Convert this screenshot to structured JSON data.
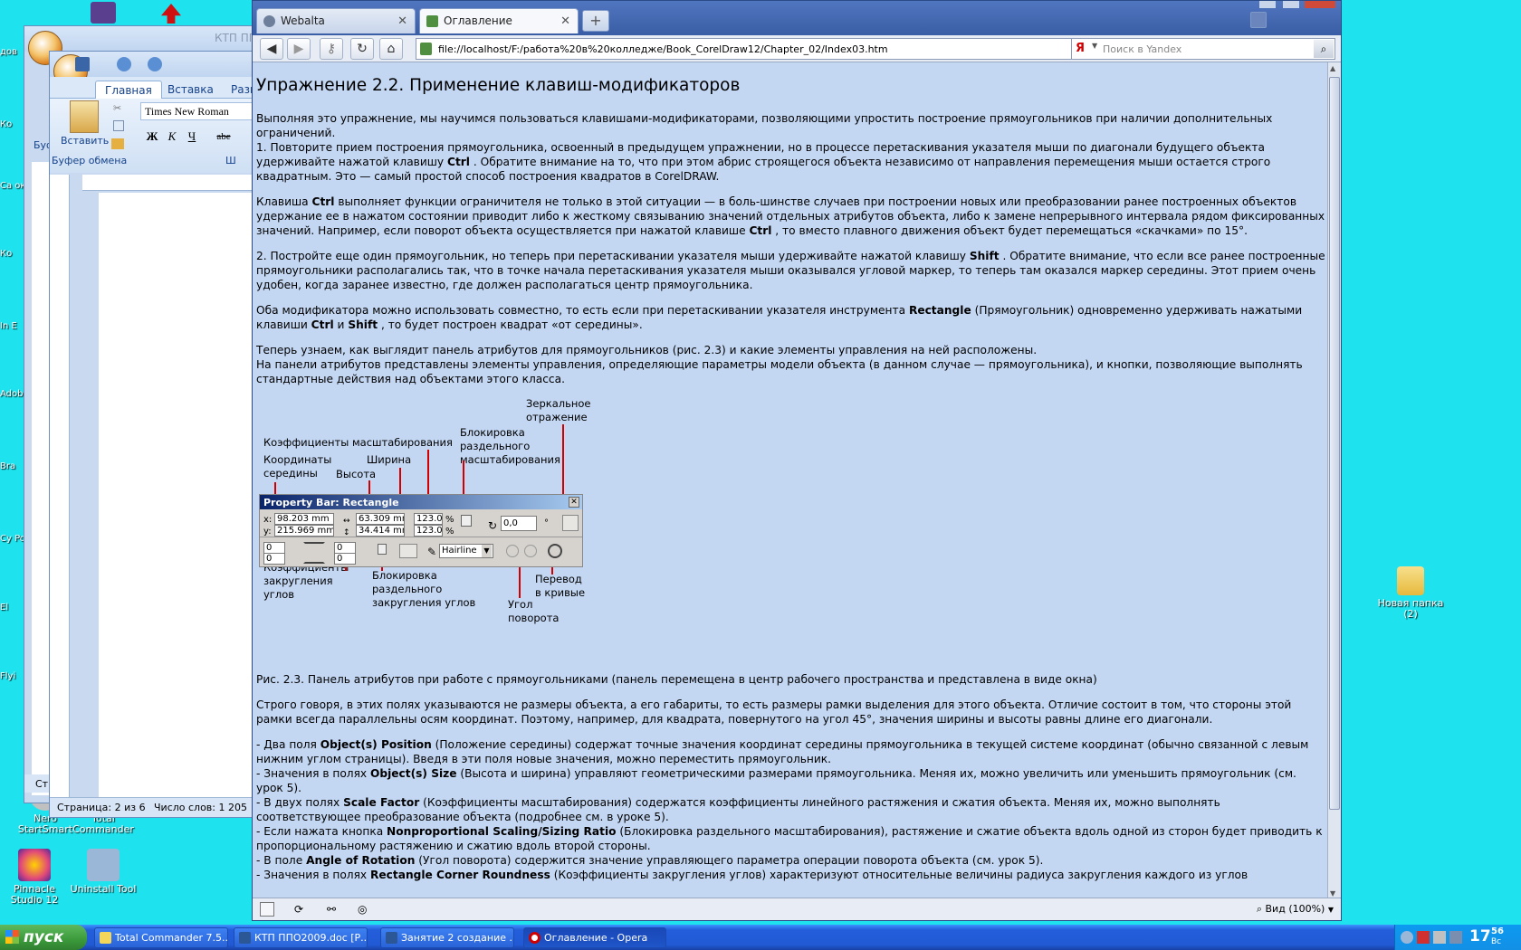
{
  "desktop": {
    "icons": [
      {
        "label": "Nero StartSmart",
        "color": "#c0c0c0"
      },
      {
        "label": "Total Commander",
        "color": "#f3d65a"
      },
      {
        "label": "Pinnacle Studio 12",
        "color": "#e0487a"
      },
      {
        "label": "Uninstall Tool",
        "color": "#9ab7d8"
      },
      {
        "label": "Новая папка (2)",
        "color": "#f2d270"
      }
    ],
    "edge_labels": [
      "дов",
      "Ко",
      "Са окр",
      "Ко",
      "In E",
      "Adob",
      "Bra",
      "Cy Pow",
      "El",
      "Flyi"
    ]
  },
  "word_back": {
    "title": "КТП ПП",
    "tab_partial": "Буф"
  },
  "word": {
    "tabs": [
      "Главная",
      "Вставка",
      "Разм"
    ],
    "paste_label": "Вставить",
    "clipboard_label": "Буфер обмена",
    "font_name": "Times New Roman",
    "format_buttons": [
      "Ж",
      "К",
      "Ч",
      "abe"
    ],
    "font_group_partial": "Ш",
    "status_page": "Страница: 2 из 6",
    "status_words": "Число слов: 1 205",
    "left_status_partial": "Ст"
  },
  "opera": {
    "tabs": [
      {
        "label": "Webalta",
        "active": false
      },
      {
        "label": "Оглавление",
        "active": true
      }
    ],
    "address": "file://localhost/F:/работа%20в%20колледже/Book_CorelDraw12/Chapter_02/Index03.htm",
    "search_engine": "Я",
    "search_placeholder": "Поиск в Yandex",
    "zoom": "Вид (100%)"
  },
  "page": {
    "heading": "Упражнение 2.2. Применение клавиш-модификаторов",
    "p1a": "Выполняя это упражнение, мы научимся пользоваться клавишами-модификаторами, позволяющими упростить построение прямоугольников при наличии дополнительных ограничений.",
    "p1b_1": "1. Повторите прием построения прямоугольника, освоенный в предыдущем упражнении, но в процессе перетаскивания указателя мыши по диагонали будущего объекта удерживайте нажатой клавишу ",
    "p1b_key": "Ctrl",
    "p1b_2": " . Обратите внимание на то, что при этом абрис строящегося объекта независимо от направления перемещения мыши остается строго квадратным. Это — самый простой способ построения квадратов в CorelDRAW.",
    "p2_1": "Клавиша ",
    "p2_key1": "Ctrl",
    "p2_2": " выполняет функции ограничителя не только в этой ситуации — в боль-шинстве случаев при построении новых или преобразовании ранее построенных объектов удержание ее в нажатом состоянии приводит либо к жесткому связыванию значений отдельных атрибутов объекта, либо к замене непрерывного интервала рядом фиксированных значений. Например, если поворот объекта осуществляется при нажатой клавише ",
    "p2_key2": "Ctrl",
    "p2_3": " , то вместо плавного движения объект будет перемещаться «скачками» по 15°.",
    "p3_1": "2. Постройте еще один прямоугольник, но теперь при перетаскивании указателя мыши удерживайте нажатой клавишу ",
    "p3_key": "Shift",
    "p3_2": " . Обратите внимание, что если все ранее построенные прямоугольники располагались так, что в точке начала перетаскивания указателя мыши оказывался угловой маркер, то теперь там оказался маркер середины. Этот прием очень удобен, когда заранее известно, где должен располагаться центр прямоугольника.",
    "p4_1": "Оба модификатора можно использовать совместно, то есть если при перетаскивании указателя инструмента ",
    "p4_key1": "Rectangle",
    "p4_2": " (Прямоугольник) одновременно удерживать нажатыми клавиши ",
    "p4_key2": "Ctrl",
    "p4_3": " и ",
    "p4_key3": "Shift",
    "p4_4": " , то будет построен квадрат «от середины».",
    "p5a": "Теперь узнаем, как выглядит панель атрибутов для прямоугольников (рис. 2.3) и какие элементы управления на ней расположены.",
    "p5b": "На панели атрибутов представлены элементы управления, определяющие параметры модели объекта (в данном случае — прямоугольника), и кнопки, позволяющие выполнять стандартные действия над объектами этого класса.",
    "caption": "Рис. 2.3. Панель атрибутов при работе с прямоугольниками (панель перемещена в центр рабочего пространства и представлена в виде окна)",
    "p6": "Строго говоря, в этих полях указываются не размеры объекта, а его габариты, то есть размеры рамки выделения для этого объекта. Отличие состоит в том, что стороны этой рамки всегда параллельны осям координат. Поэтому, например, для квадрата, повернутого на угол 45°, значения ширины и высоты равны длине его диагонали.",
    "b1_1": "- Два поля ",
    "b1_key": "Object(s) Position",
    "b1_2": " (Положение середины) содержат точные значения координат середины прямоугольника в текущей системе координат (обычно связанной с левым нижним углом страницы). Введя в эти поля новые значения, можно переместить прямоугольник.",
    "b2_1": "- Значения в полях ",
    "b2_key": "Object(s) Size",
    "b2_2": " (Высота и ширина) управляют геометрическими размерами прямоугольника. Меняя их, можно увеличить или уменьшить прямоугольник (см. урок 5).",
    "b3_1": "- В двух полях ",
    "b3_key": "Scale Factor",
    "b3_2": " (Коэффициенты масштабирования) содержатся коэффициенты линейного растяжения и сжатия объекта. Меняя их, можно выполнять соответствующее преобразование объекта (подробнее см. в уроке 5).",
    "b4_1": "- Если нажата кнопка ",
    "b4_key": "Nonproportional Scaling/Sizing Ratio",
    "b4_2": " (Блокировка раздельного масштабирования), растяжение и сжатие объекта вдоль одной из сторон будет приводить к пропорциональному растяжению и сжатию вдоль второй стороны.",
    "b5_1": "- В поле ",
    "b5_key": "Angle of Rotation",
    "b5_2": " (Угол поворота) содержится значение управляющего параметра операции поворота объекта (см. урок 5).",
    "b6_1": "- Значения в полях ",
    "b6_key": "Rectangle Corner Roundness",
    "b6_2": " (Коэффициенты закругления углов) характеризуют относительные величины радиуса закругления каждого из углов"
  },
  "figure": {
    "labels": {
      "mirror": "Зеркальное отражение",
      "scale": "Коэффициенты масштабирования",
      "lock_scale": "Блокировка раздельного масштабирования",
      "coords": "Координаты середины",
      "width": "Ширина",
      "height": "Высота",
      "corner": "Коэффициенты закругления углов",
      "lock_round": "Блокировка раздельного закругления углов",
      "to_curves": "Перевод в кривые",
      "angle": "Угол поворота"
    },
    "property_bar": {
      "title": "Property Bar: Rectangle",
      "x_label": "x:",
      "y_label": "y:",
      "x": "98.203 mm",
      "y": "215.969 mm",
      "w": "63.309 mm",
      "h": "34.414 mm",
      "sx": "123.0",
      "sy": "123.0",
      "pct": "%",
      "angle": "0,0",
      "deg": "°",
      "c1": "0",
      "c2": "0",
      "c3": "0",
      "c4": "0",
      "outline": "Hairline"
    }
  },
  "taskbar": {
    "start": "пуск",
    "buttons": [
      {
        "label": "Total Commander 7.5...",
        "active": false
      },
      {
        "label": "КТП ППО2009.doc [Р...",
        "active": false
      },
      {
        "label": "Занятие 2 создание ...",
        "active": false
      },
      {
        "label": "Оглавление - Opera",
        "active": true
      }
    ],
    "clock": "17",
    "clock_min": "56",
    "clock_day": "Вс"
  }
}
